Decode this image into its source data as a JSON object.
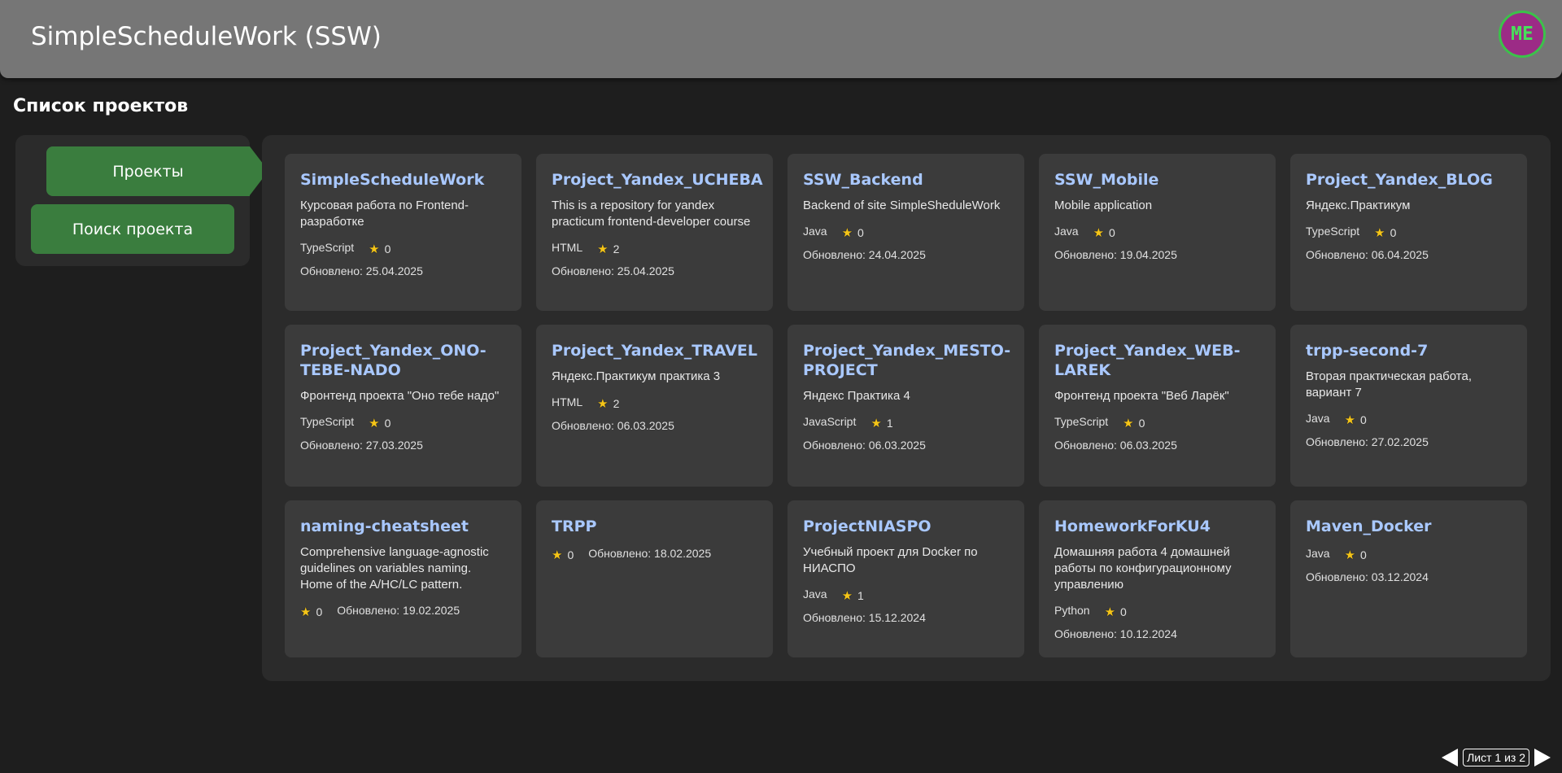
{
  "header": {
    "title": "SimpleScheduleWork (SSW)",
    "avatar_text": "ME"
  },
  "page": {
    "heading": "Список проектов"
  },
  "nav": {
    "active_label": "Проекты",
    "search_label": "Поиск проекта"
  },
  "updated_prefix": "Обновлено:",
  "projects": [
    {
      "title": "SimpleScheduleWork",
      "desc": "Курсовая работа по Frontend-разработке",
      "lang": "TypeScript",
      "stars": "0",
      "updated": "25.04.2025"
    },
    {
      "title": "Project_Yandex_UCHEBA",
      "desc": "This is a repository for yandex practicum frontend-developer course",
      "lang": "HTML",
      "stars": "2",
      "updated": "25.04.2025"
    },
    {
      "title": "SSW_Backend",
      "desc": "Backend of site SimpleSheduleWork",
      "lang": "Java",
      "stars": "0",
      "updated": "24.04.2025"
    },
    {
      "title": "SSW_Mobile",
      "desc": "Mobile application",
      "lang": "Java",
      "stars": "0",
      "updated": "19.04.2025"
    },
    {
      "title": "Project_Yandex_BLOG",
      "desc": "Яндекс.Практикум",
      "lang": "TypeScript",
      "stars": "0",
      "updated": "06.04.2025"
    },
    {
      "title": "Project_Yandex_ONO-TEBE-NADO",
      "desc": "Фронтенд проекта \"Оно тебе надо\"",
      "lang": "TypeScript",
      "stars": "0",
      "updated": "27.03.2025"
    },
    {
      "title": "Project_Yandex_TRAVEL",
      "desc": "Яндекс.Практикум практика 3",
      "lang": "HTML",
      "stars": "2",
      "updated": "06.03.2025"
    },
    {
      "title": "Project_Yandex_MESTO-PROJECT",
      "desc": "Яндекс Практика 4",
      "lang": "JavaScript",
      "stars": "1",
      "updated": "06.03.2025"
    },
    {
      "title": "Project_Yandex_WEB-LAREK",
      "desc": "Фронтенд проекта \"Веб Ларёк\"",
      "lang": "TypeScript",
      "stars": "0",
      "updated": "06.03.2025"
    },
    {
      "title": "trpp-second-7",
      "desc": "Вторая практическая работа, вариант 7",
      "lang": "Java",
      "stars": "0",
      "updated": "27.02.2025"
    },
    {
      "title": "naming-cheatsheet",
      "desc": "Comprehensive language-agnostic guidelines on variables naming. Home of the A/HC/LC pattern.",
      "lang": "",
      "stars": "0",
      "updated": "19.02.2025"
    },
    {
      "title": "TRPP",
      "desc": "",
      "lang": "",
      "stars": "0",
      "updated": "18.02.2025"
    },
    {
      "title": "ProjectNIASPO",
      "desc": "Учебный проект для Docker по НИАСПО",
      "lang": "Java",
      "stars": "1",
      "updated": "15.12.2024"
    },
    {
      "title": "HomeworkForKU4",
      "desc": "Домашняя работа 4 домашней работы по конфигурационному управлению",
      "lang": "Python",
      "stars": "0",
      "updated": "10.12.2024"
    },
    {
      "title": "Maven_Docker",
      "desc": "",
      "lang": "Java",
      "stars": "0",
      "updated": "03.12.2024"
    }
  ],
  "pager": {
    "label": "Лист 1 из 2"
  }
}
